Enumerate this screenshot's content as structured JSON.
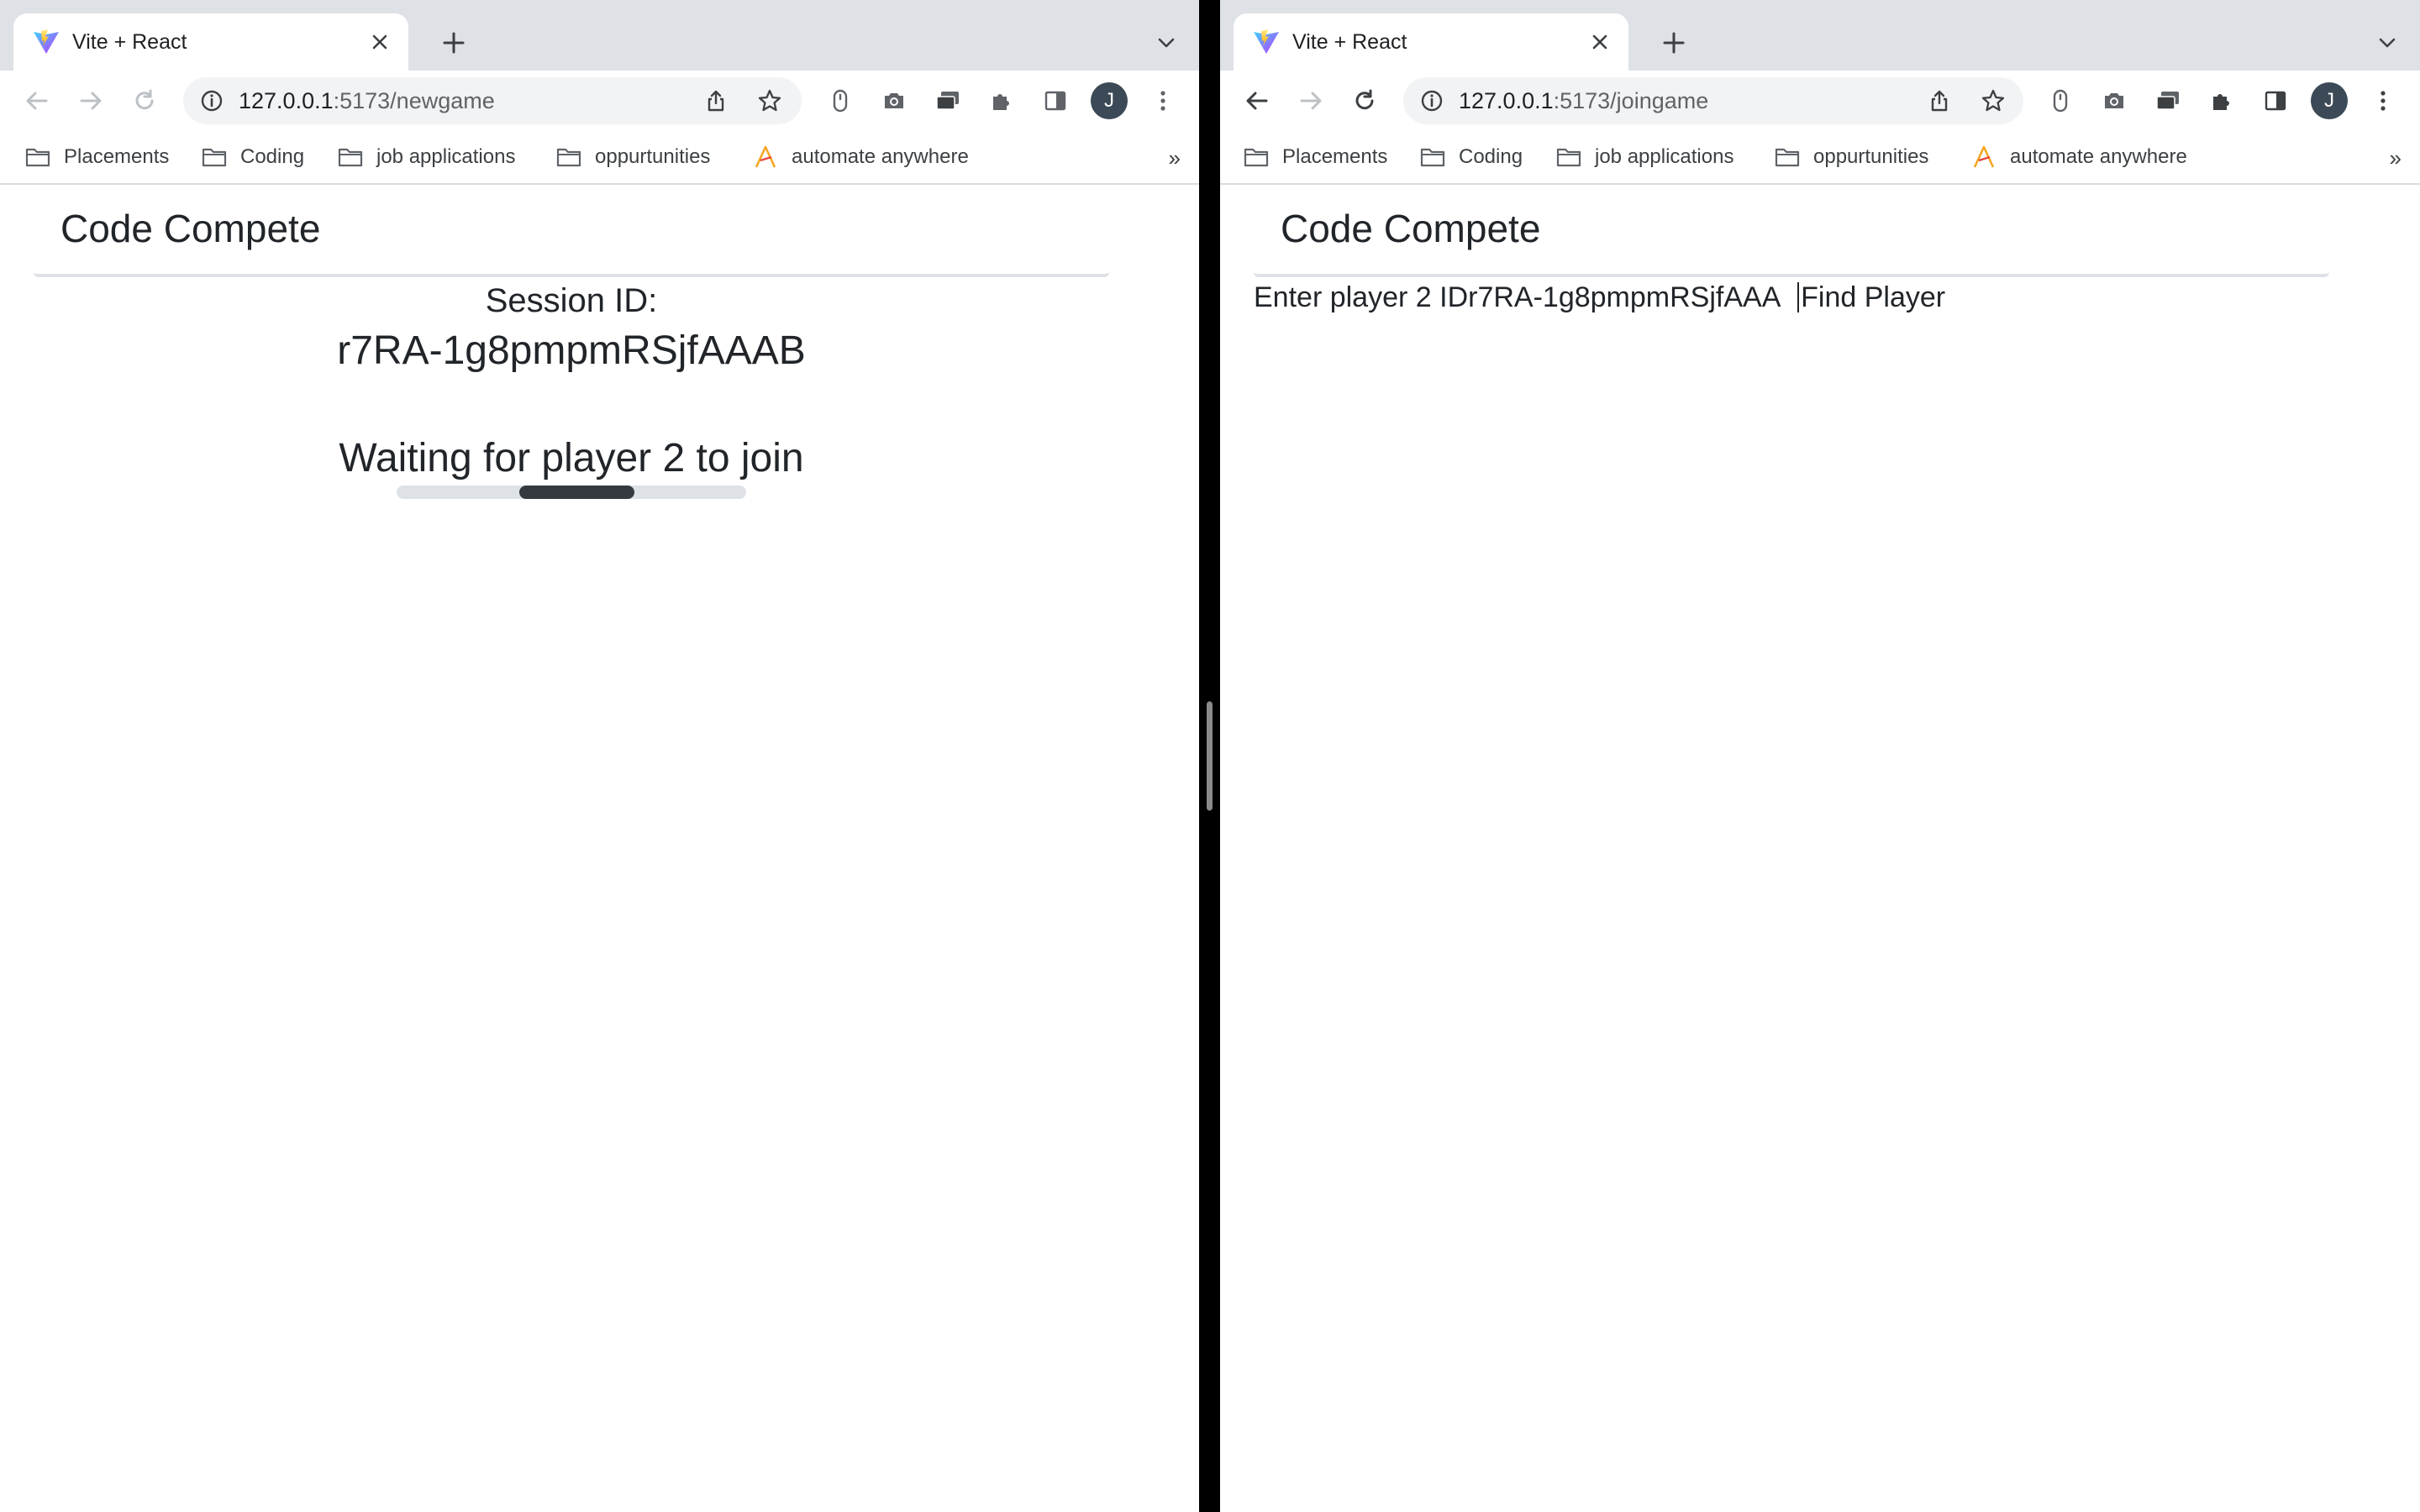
{
  "colors": {
    "tabstrip": "#dee1e6",
    "omnibox": "#f1f3f4",
    "avatar": "#3c4a57",
    "text": "#212529",
    "progress_track": "#dee2e6",
    "progress_bar": "#343a40"
  },
  "bookmarks": [
    {
      "label": "Placements",
      "icon": "folder-icon"
    },
    {
      "label": "Coding",
      "icon": "folder-icon"
    },
    {
      "label": "job applications",
      "icon": "folder-icon"
    },
    {
      "label": "oppurtunities",
      "icon": "folder-icon"
    },
    {
      "label": "automate anywhere",
      "icon": "automation-anywhere-icon"
    }
  ],
  "bookmarks_overflow": "»",
  "left_window": {
    "tab": {
      "title": "Vite + React",
      "favicon": "vite-icon"
    },
    "url_host": "127.0.0.1",
    "url_rest": ":5173/newgame",
    "avatar_initial": "J",
    "page": {
      "brand": "Code Compete",
      "session_label": "Session ID:",
      "session_id": "r7RA-1g8pmpmRSjfAAAB",
      "waiting_text": "Waiting for player 2 to join",
      "progress": {
        "start": 0.35,
        "end": 0.68
      }
    }
  },
  "right_window": {
    "tab": {
      "title": "Vite + React",
      "favicon": "vite-icon"
    },
    "url_host": "127.0.0.1",
    "url_rest": ":5173/joingame",
    "avatar_initial": "J",
    "page": {
      "brand": "Code Compete",
      "join_label": "Enter player 2 ID",
      "player_id_value": "r7RA-1g8pmpmRSjfAAA",
      "find_button": "Find Player"
    }
  }
}
